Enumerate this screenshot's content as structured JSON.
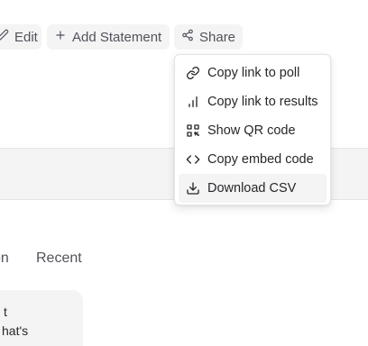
{
  "toolbar": {
    "edit_label": "Edit",
    "add_statement_label": "Add Statement",
    "share_label": "Share"
  },
  "tabs": {
    "partial_label": "on",
    "recent_label": "Recent"
  },
  "card": {
    "line1": "t",
    "line2": "hat's"
  },
  "share_menu": {
    "items": [
      {
        "label": "Copy link to poll",
        "icon": "link-icon"
      },
      {
        "label": "Copy link to results",
        "icon": "bar-chart-icon"
      },
      {
        "label": "Show QR code",
        "icon": "qr-code-icon"
      },
      {
        "label": "Copy embed code",
        "icon": "code-icon"
      },
      {
        "label": "Download CSV",
        "icon": "download-icon"
      }
    ],
    "highlighted_item": "Download CSV"
  },
  "colors": {
    "button_bg": "#f4f4f5",
    "text_muted": "#52525b",
    "text": "#27272a",
    "border": "#e4e4e7",
    "highlight": "#f4f4f5"
  }
}
